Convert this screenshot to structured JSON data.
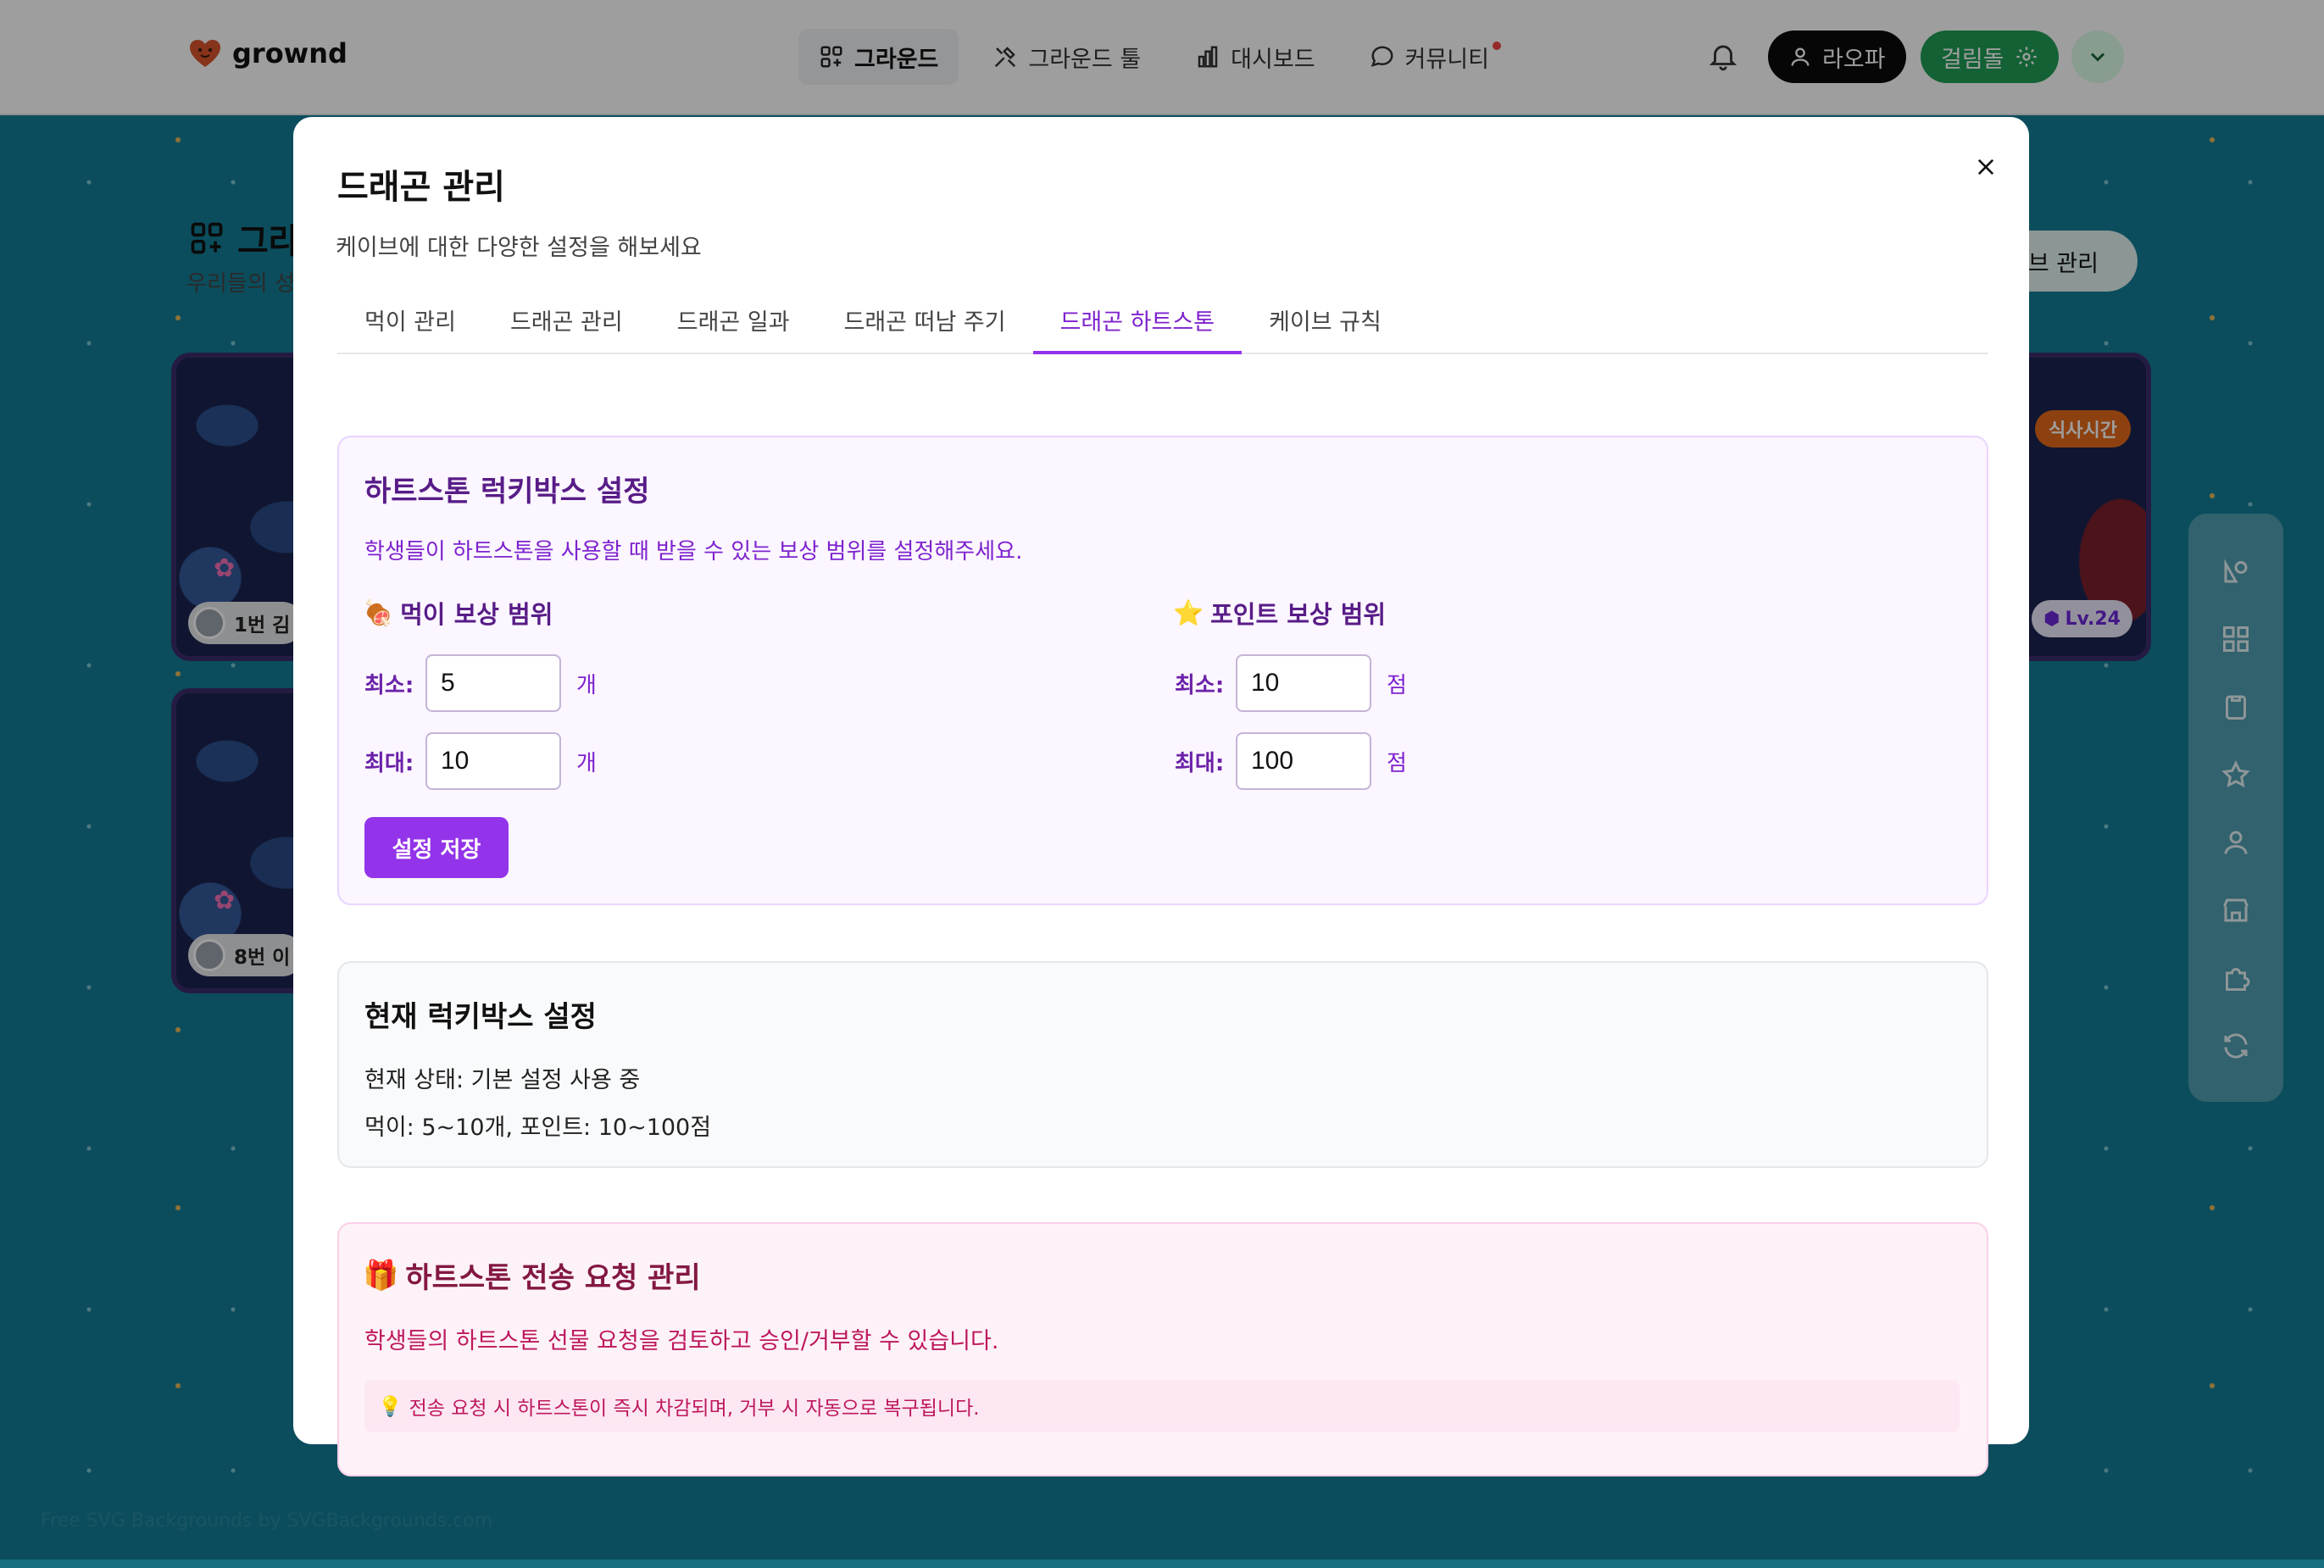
{
  "header": {
    "logo_text": "grownd",
    "nav": [
      {
        "label": "그라운드",
        "active": true
      },
      {
        "label": "그라운드 툴",
        "active": false
      },
      {
        "label": "대시보드",
        "active": false
      },
      {
        "label": "커뮤니티",
        "active": false
      }
    ],
    "user_label": "라오파",
    "cave_label": "걸림돌"
  },
  "page": {
    "title": "그라",
    "subtitle": "우리들의 성",
    "manage_label": "이브 관리",
    "credit": "Free SVG Backgrounds by SVGBackgrounds.com",
    "cards": [
      {
        "label": "1번 김"
      },
      {
        "label": "8번 이"
      }
    ],
    "right_card": {
      "meal": "식사시간",
      "level": "Lv.24"
    }
  },
  "modal": {
    "title": "드래곤 관리",
    "description": "케이브에 대한 다양한 설정을 해보세요",
    "tabs": [
      {
        "label": "먹이 관리"
      },
      {
        "label": "드래곤 관리"
      },
      {
        "label": "드래곤 일과"
      },
      {
        "label": "드래곤 떠남 주기"
      },
      {
        "label": "드래곤 하트스톤"
      },
      {
        "label": "케이브 규칙"
      }
    ],
    "active_tab": "드래곤 하트스톤",
    "luckybox": {
      "heading": "하트스톤 럭키박스 설정",
      "description": "학생들이 하트스톤을 사용할 때 받을 수 있는 보상 범위를 설정해주세요.",
      "food": {
        "title": "먹이 보상 범위",
        "emoji": "🍖",
        "min_label": "최소:",
        "min_value": "5",
        "max_label": "최대:",
        "max_value": "10",
        "unit": "개"
      },
      "points": {
        "title": "포인트 보상 범위",
        "emoji": "⭐",
        "min_label": "최소:",
        "min_value": "10",
        "max_label": "최대:",
        "max_value": "100",
        "unit": "점"
      },
      "save_label": "설정 저장"
    },
    "current": {
      "heading": "현재 럭키박스 설정",
      "status": "현재 상태: 기본 설정 사용 중",
      "summary": "먹이: 5~10개, 포인트: 10~100점"
    },
    "requests": {
      "emoji": "🎁",
      "heading": "하트스톤 전송 요청 관리",
      "description": "학생들의 하트스톤 선물 요청을 검토하고 승인/거부할 수 있습니다.",
      "tip_icon": "💡",
      "tip": "전송 요청 시 하트스톤이 즉시 차감되며, 거부 시 자동으로 복구됩니다."
    }
  }
}
